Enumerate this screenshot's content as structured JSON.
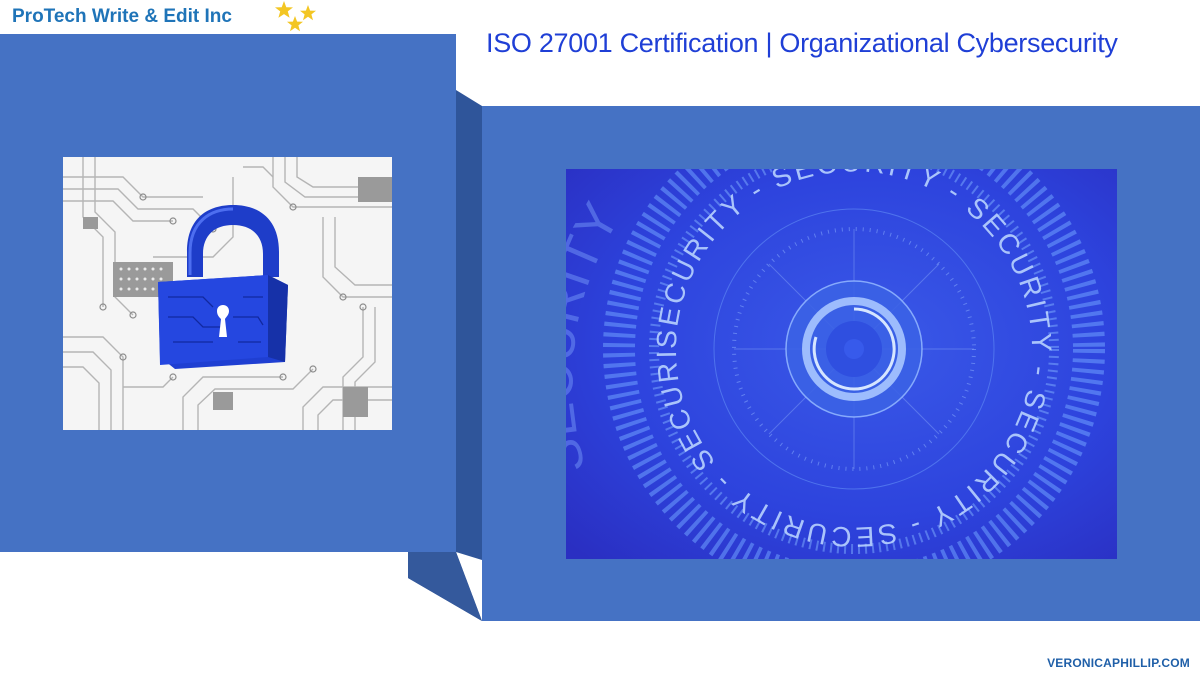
{
  "brand": {
    "name": "ProTech Write & Edit Inc",
    "star_color": "#f3c623",
    "text_color": "#1f74b8"
  },
  "headline": "ISO 27001 Certification | Organizational Cybersecurity",
  "footer_url": "VERONICAPHILLIP.COM",
  "ring_text": "SECURITY - SECURITY - SECURITY - SECURITY - SECURITY - SECURITY -",
  "outer_ring_text": "SECURITY",
  "colors": {
    "panel": "#4572c4",
    "panel_dark": "#2f559a",
    "headline": "#1f3fd6",
    "security_bg": "#2e3fe0"
  },
  "icons": {
    "lock": "padlock-icon",
    "logo_stars": "stars-icon"
  }
}
